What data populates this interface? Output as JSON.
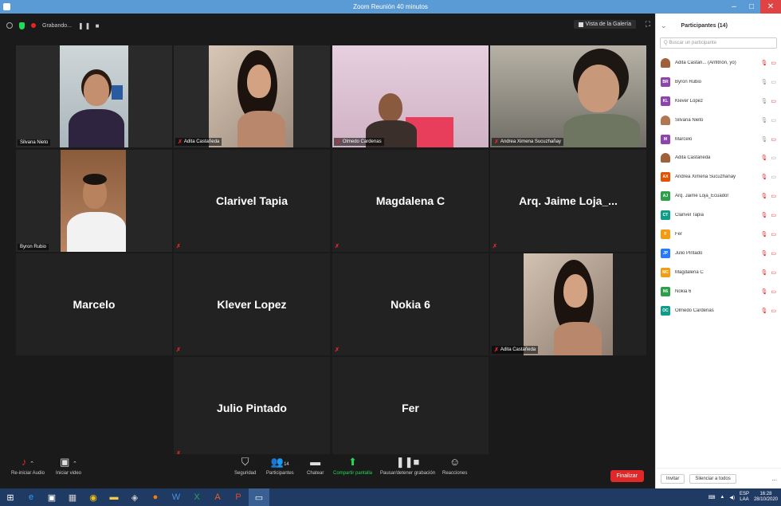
{
  "window": {
    "title": "Zoom Reunión 40 minutos"
  },
  "topbar": {
    "recording_label": "Grabando...",
    "view_label": "Vista de la Galería"
  },
  "tiles": [
    {
      "name": "Silvana Nieto",
      "muted": false
    },
    {
      "name": "Adita Castañeda",
      "muted": true
    },
    {
      "name": "Olmedo Cardenas",
      "muted": true
    },
    {
      "name": "Andrea Ximena Sucuzhañay",
      "muted": true
    },
    {
      "name": "Byron Rubio",
      "muted": false
    },
    {
      "name": "Clarivel Tapia",
      "muted": true
    },
    {
      "name": "Magdalena C",
      "muted": true
    },
    {
      "name": "Arq. Jaime Loja_...",
      "muted": true
    },
    {
      "name": "Marcelo",
      "muted": false
    },
    {
      "name": "Klever Lopez",
      "muted": true
    },
    {
      "name": "Nokia 6",
      "muted": true
    },
    {
      "name": "Adita Castañeda",
      "muted": true
    },
    {
      "name": "Julio Pintado",
      "muted": true
    },
    {
      "name": "Fer",
      "muted": false
    }
  ],
  "controls": {
    "audio": "Re-iniciar Audio",
    "video": "Iniciar video",
    "security": "Seguridad",
    "participants": "Participantes",
    "participants_count": "14",
    "chat": "Chatear",
    "share": "Compartir pantalla",
    "record": "Pausar/detener grabación",
    "reactions": "Reacciones",
    "end": "Finalizar"
  },
  "panel": {
    "title": "Participantes (14)",
    "search_placeholder": "Q Buscar un participante",
    "participants": [
      {
        "name": "Adita Castañ... (Anfitrión, yo)",
        "initials": "",
        "color": "#a0603a",
        "photo": true,
        "mic": false,
        "video": false
      },
      {
        "name": "Byron Rubio",
        "initials": "BR",
        "color": "#8e44ad",
        "photo": false,
        "mic": true,
        "video": true
      },
      {
        "name": "Klever Lopez",
        "initials": "KL",
        "color": "#8e44ad",
        "photo": false,
        "mic": true,
        "video": false
      },
      {
        "name": "Silvana Nieto",
        "initials": "",
        "color": "#b07850",
        "photo": true,
        "mic": true,
        "video": true
      },
      {
        "name": "Marcelo",
        "initials": "M",
        "color": "#8e44ad",
        "photo": false,
        "mic": true,
        "video": false
      },
      {
        "name": "Adita Castañeda",
        "initials": "",
        "color": "#a0603a",
        "photo": true,
        "mic": false,
        "video": true
      },
      {
        "name": "Andrea Ximena Sucuzhañay",
        "initials": "AX",
        "color": "#e65100",
        "photo": false,
        "mic": false,
        "video": true
      },
      {
        "name": "Arq. Jaime Loja_Ecuador",
        "initials": "AJ",
        "color": "#2e9e48",
        "photo": false,
        "mic": false,
        "video": false
      },
      {
        "name": "Clarivel Tapia",
        "initials": "CT",
        "color": "#0f9d8a",
        "photo": false,
        "mic": false,
        "video": false
      },
      {
        "name": "Fer",
        "initials": "F",
        "color": "#f39c12",
        "photo": false,
        "mic": false,
        "video": false
      },
      {
        "name": "Julio Pintado",
        "initials": "JP",
        "color": "#2979ff",
        "photo": false,
        "mic": false,
        "video": false
      },
      {
        "name": "Magdalena C",
        "initials": "MC",
        "color": "#f39c12",
        "photo": false,
        "mic": false,
        "video": false
      },
      {
        "name": "Nokia 6",
        "initials": "N6",
        "color": "#2e9e48",
        "photo": false,
        "mic": false,
        "video": false
      },
      {
        "name": "Olmedo Cardenas",
        "initials": "OC",
        "color": "#0f9d8a",
        "photo": false,
        "mic": false,
        "video": false
      }
    ],
    "invite": "Invitar",
    "mute_all": "Silenciar a todos",
    "more": "..."
  },
  "taskbar": {
    "lang_top": "ESP",
    "lang_bottom": "LAA",
    "time": "16:28",
    "date": "28/10/2020"
  }
}
